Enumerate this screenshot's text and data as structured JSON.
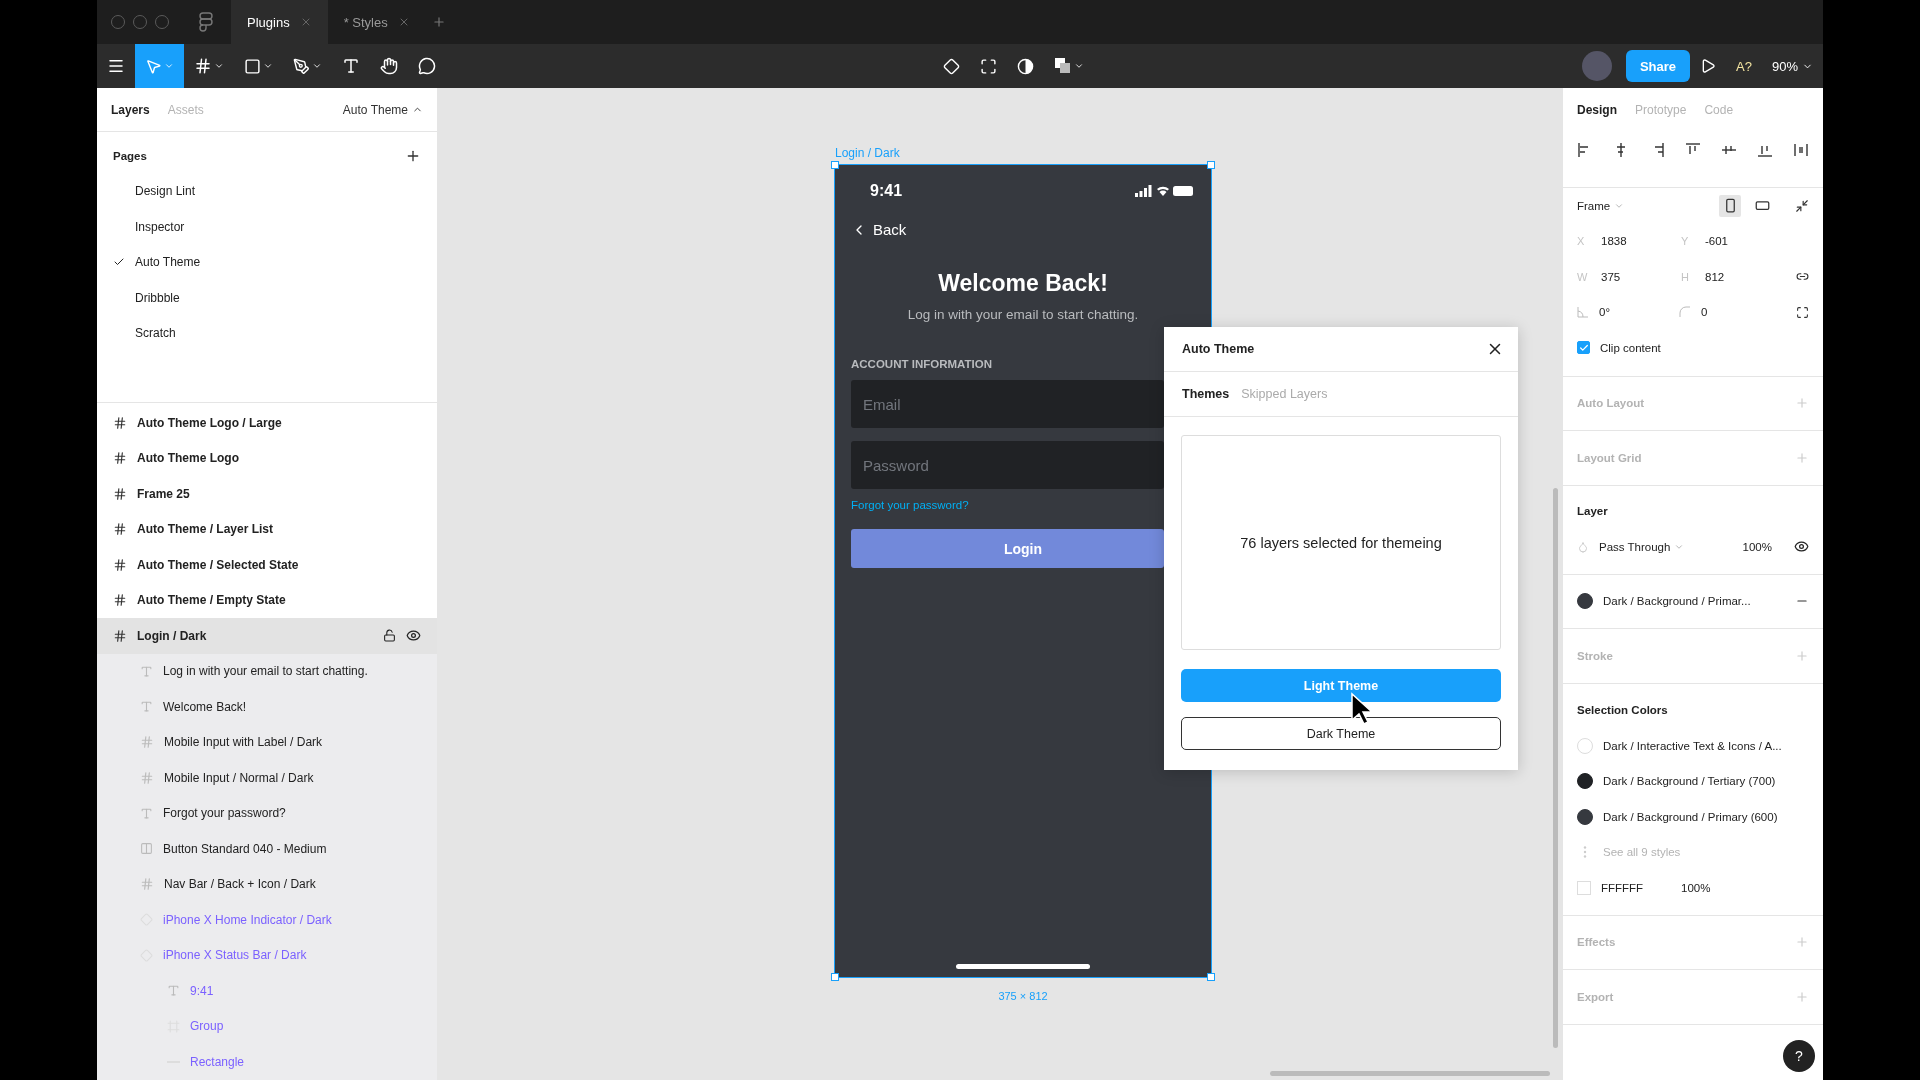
{
  "window_tabs": [
    {
      "label": "Plugins",
      "selected": true
    },
    {
      "label": "* Styles",
      "selected": false
    }
  ],
  "toolbar": {
    "share": "Share",
    "font_check": "A?",
    "zoom": "90%"
  },
  "left_panel": {
    "tabs": [
      {
        "label": "Layers",
        "selected": true
      },
      {
        "label": "Assets",
        "selected": false
      }
    ],
    "page_switcher": "Auto Theme",
    "pages_title": "Pages",
    "pages": [
      {
        "label": "Design Lint",
        "selected": false
      },
      {
        "label": "Inspector",
        "selected": false
      },
      {
        "label": "Auto Theme",
        "selected": true
      },
      {
        "label": "Dribbble",
        "selected": false
      },
      {
        "label": "Scratch",
        "selected": false
      }
    ],
    "layers": [
      {
        "label": "Auto Theme Logo / Large",
        "kind": "frame",
        "selected": false
      },
      {
        "label": "Auto Theme Logo",
        "kind": "frame",
        "selected": false
      },
      {
        "label": "Frame 25",
        "kind": "frame",
        "selected": false
      },
      {
        "label": "Auto Theme / Layer List",
        "kind": "frame",
        "selected": false
      },
      {
        "label": "Auto Theme / Selected State",
        "kind": "frame",
        "selected": false
      },
      {
        "label": "Auto Theme / Empty State",
        "kind": "frame",
        "selected": false
      },
      {
        "label": "Login / Dark",
        "kind": "frame",
        "selected": true,
        "children": [
          {
            "label": "Log in with your email to start chatting.",
            "kind": "text",
            "selected": false
          },
          {
            "label": "Welcome Back!",
            "kind": "text",
            "selected": false
          },
          {
            "label": "Mobile Input with Label / Dark",
            "kind": "frame",
            "selected": false
          },
          {
            "label": "Mobile Input / Normal / Dark",
            "kind": "frame",
            "selected": false
          },
          {
            "label": "Forgot your password?",
            "kind": "text",
            "selected": false
          },
          {
            "label": "Button Standard 040 - Medium",
            "kind": "autolayout",
            "selected": false
          },
          {
            "label": "Nav Bar / Back + Icon / Dark",
            "kind": "frame",
            "selected": false
          },
          {
            "label": "iPhone X Home Indicator / Dark",
            "kind": "instance",
            "selected": false
          },
          {
            "label": "iPhone X Status Bar / Dark",
            "kind": "instance",
            "selected": false,
            "children": [
              {
                "label": "9:41",
                "kind": "text",
                "selected": false
              },
              {
                "label": "Group",
                "kind": "group",
                "selected": false
              },
              {
                "label": "Rectangle",
                "kind": "rectangle",
                "selected": false
              }
            ]
          }
        ]
      }
    ]
  },
  "canvas": {
    "frame_label": "Login / Dark",
    "frame_size": "375 × 812",
    "phone": {
      "time": "9:41",
      "back": "Back",
      "title": "Welcome Back!",
      "subtitle": "Log in with your email to start chatting.",
      "section": "ACCOUNT INFORMATION",
      "fields": [
        {
          "placeholder": "Email"
        },
        {
          "placeholder": "Password"
        }
      ],
      "link": "Forgot your password?",
      "button": "Login"
    },
    "plugin": {
      "title": "Auto Theme",
      "tabs": [
        {
          "label": "Themes",
          "selected": true
        },
        {
          "label": "Skipped Layers",
          "selected": false
        }
      ],
      "message": "76 layers selected for themeing",
      "buttons": [
        {
          "label": "Light Theme",
          "kind": "primary"
        },
        {
          "label": "Dark Theme",
          "kind": "secondary"
        }
      ]
    }
  },
  "right_panel": {
    "tabs": [
      {
        "label": "Design",
        "selected": true
      },
      {
        "label": "Prototype",
        "selected": false
      },
      {
        "label": "Code",
        "selected": false
      }
    ],
    "frame": {
      "type": "Frame",
      "orientations": [
        {
          "kind": "portrait",
          "selected": true
        },
        {
          "kind": "landscape",
          "selected": false
        }
      ],
      "fields": [
        {
          "label": "X",
          "value": "1838"
        },
        {
          "label": "Y",
          "value": "-601"
        },
        {
          "label": "W",
          "value": "375"
        },
        {
          "label": "H",
          "value": "812"
        }
      ],
      "rotation": "0°",
      "radius": "0",
      "clip": {
        "label": "Clip content",
        "checked": true
      }
    },
    "auto_layout": "Auto Layout",
    "layout_grid": "Layout Grid",
    "layer": {
      "title": "Layer",
      "blend": "Pass Through",
      "opacity": "100%"
    },
    "fill": {
      "name": "Dark / Background / Primar...",
      "color": "#36393f"
    },
    "stroke": "Stroke",
    "selection_colors": {
      "title": "Selection Colors",
      "items": [
        {
          "name": "Dark / Interactive Text & Icons / A...",
          "color": "#ffffff"
        },
        {
          "name": "Dark / Background / Tertiary (700)",
          "color": "#202225"
        },
        {
          "name": "Dark / Background / Primary (600)",
          "color": "#36393f"
        }
      ],
      "see_all": "See all 9 styles",
      "hex": {
        "value": "FFFFFF",
        "opacity": "100%"
      }
    },
    "effects": "Effects",
    "export": "Export",
    "help": "?"
  }
}
